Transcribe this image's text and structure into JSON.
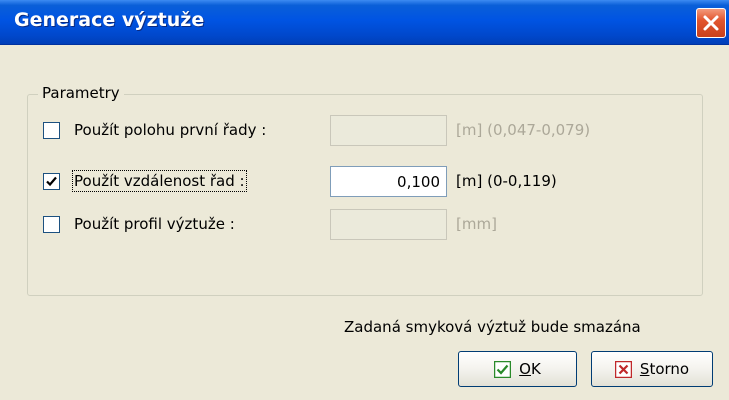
{
  "window": {
    "title": "Generace výztuže"
  },
  "group": {
    "label": "Parametry"
  },
  "rows": [
    {
      "label": "Použít polohu první řady :",
      "checked": false,
      "value": "",
      "unit": "[m]",
      "range": "(0,047-0,079)",
      "enabled": false
    },
    {
      "label": "Použít vzdálenost řad :",
      "checked": true,
      "value": "0,100",
      "unit": "[m]",
      "range": "(0-0,119)",
      "enabled": true
    },
    {
      "label": "Použít profil výztuže :",
      "checked": false,
      "value": "",
      "unit": "[mm]",
      "range": "",
      "enabled": false
    }
  ],
  "info_text": "Zadaná smyková výztuž bude smazána",
  "buttons": {
    "ok": {
      "label_first": "O",
      "label_rest": "K",
      "icon": "check-icon"
    },
    "cancel": {
      "label_first": "S",
      "label_rest": "torno",
      "icon": "cross-icon"
    }
  },
  "colors": {
    "titlebar": "#0054e3",
    "dialog_bg": "#ece9d8",
    "ok_icon": "#2a8a2a",
    "cancel_icon": "#c0282a"
  }
}
